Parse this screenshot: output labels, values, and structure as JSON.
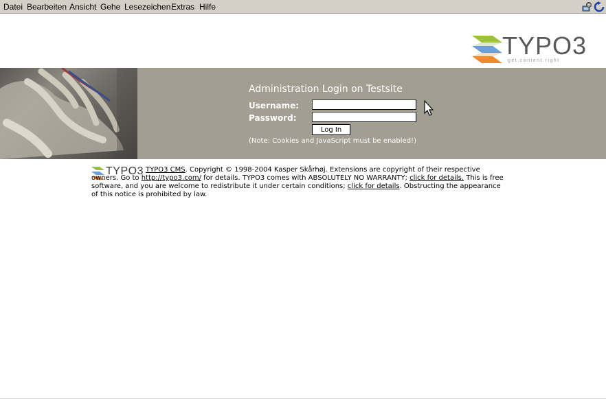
{
  "menu": [
    "Datei",
    "Bearbeiten",
    "Ansicht",
    "Gehe",
    "Lesezeichen",
    "Extras",
    "Hilfe"
  ],
  "logo": {
    "word": "TYPO3",
    "slogan": "get.content.right"
  },
  "login": {
    "title": "Administration Login on Testsite",
    "username_label": "Username:",
    "password_label": "Password:",
    "username_value": "",
    "password_value": "",
    "button": "Log In",
    "note": "(Note: Cookies and JavaScript must be enabled!)"
  },
  "copyright": {
    "logo_word": "TYPO3",
    "cms_link": "TYPO3 CMS",
    "text1": ". Copyright © 1998-2004 Kasper Skårhøj. Extensions are copyright of their respective owners. Go to ",
    "site_link": "http://typo3.com/",
    "text2": " for details. TYPO3 comes with ABSOLUTELY NO WARRANTY; ",
    "details_link1": "click for details.",
    "text3": " This is free software, and you are welcome to redistribute it under certain conditions; ",
    "details_link2": "click for details",
    "text4": ". Obstructing the appearance of this notice is prohibited by law."
  },
  "colors": {
    "band": "#a29f92",
    "logo_green": "#9cc23c",
    "logo_blue": "#6f9fd8",
    "logo_orange": "#f08a2a"
  },
  "icons": [
    "network-settings-icon",
    "reload-icon",
    "mouse-cursor-icon"
  ]
}
